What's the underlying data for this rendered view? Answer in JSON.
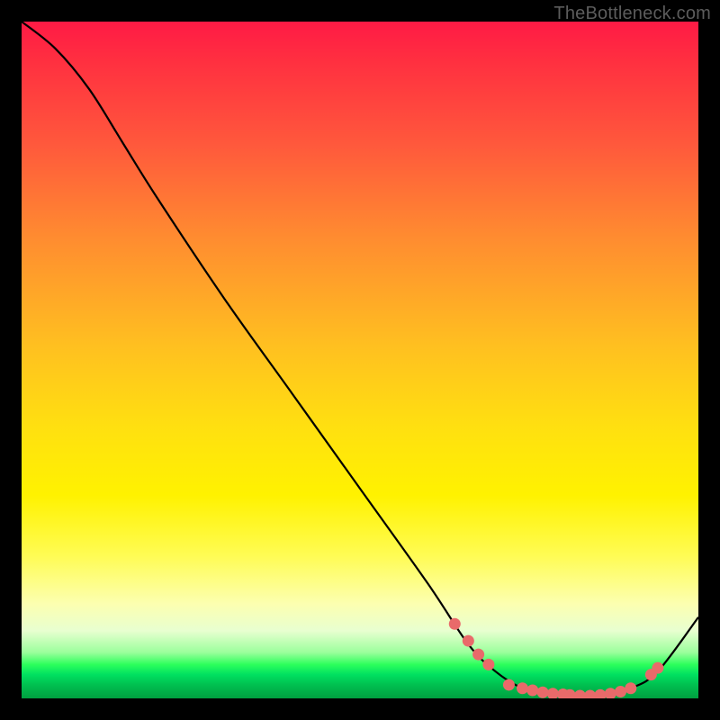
{
  "attribution": "TheBottleneck.com",
  "chart_data": {
    "type": "line",
    "title": "",
    "xlabel": "",
    "ylabel": "",
    "xlim": [
      0,
      100
    ],
    "ylim": [
      0,
      100
    ],
    "series": [
      {
        "name": "curve",
        "x": [
          0,
          5,
          10,
          15,
          20,
          30,
          40,
          50,
          60,
          66,
          70,
          74,
          78,
          82,
          86,
          90,
          94,
          100
        ],
        "y": [
          100,
          96,
          90,
          82,
          74,
          59,
          45,
          31,
          17,
          8,
          4,
          1.5,
          0.5,
          0.3,
          0.5,
          1.5,
          4,
          12
        ]
      }
    ],
    "markers": [
      {
        "x": 64.0,
        "y": 11.0
      },
      {
        "x": 66.0,
        "y": 8.5
      },
      {
        "x": 67.5,
        "y": 6.5
      },
      {
        "x": 69.0,
        "y": 5.0
      },
      {
        "x": 72.0,
        "y": 2.0
      },
      {
        "x": 74.0,
        "y": 1.5
      },
      {
        "x": 75.5,
        "y": 1.2
      },
      {
        "x": 77.0,
        "y": 0.9
      },
      {
        "x": 78.5,
        "y": 0.7
      },
      {
        "x": 80.0,
        "y": 0.6
      },
      {
        "x": 81.0,
        "y": 0.5
      },
      {
        "x": 82.5,
        "y": 0.4
      },
      {
        "x": 84.0,
        "y": 0.4
      },
      {
        "x": 85.5,
        "y": 0.5
      },
      {
        "x": 87.0,
        "y": 0.7
      },
      {
        "x": 88.5,
        "y": 1.0
      },
      {
        "x": 90.0,
        "y": 1.5
      },
      {
        "x": 93.0,
        "y": 3.5
      },
      {
        "x": 94.0,
        "y": 4.5
      }
    ],
    "marker_color": "#e96a6a",
    "curve_color": "#000000"
  }
}
